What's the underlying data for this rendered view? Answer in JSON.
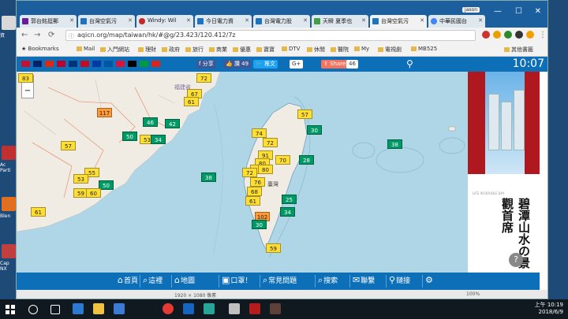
{
  "desktop": {
    "icons": [
      {
        "label": "資",
        "color": "#d8d8d8"
      },
      {
        "label": "Ac Parti",
        "color": "#c03030"
      },
      {
        "label": "Blen",
        "color": "#e07020"
      },
      {
        "label": "Cap NX",
        "color": "#c04040"
      }
    ]
  },
  "browser": {
    "tabs": [
      {
        "label": "郭台銘挺郵",
        "color": "#6a1b9a"
      },
      {
        "label": "台灣空氣污",
        "color": "#1e73be"
      },
      {
        "label": "Windy: Wil",
        "color": "#c62828"
      },
      {
        "label": "今日電力資",
        "color": "#1e73be"
      },
      {
        "label": "台灣電力股",
        "color": "#1e73be"
      },
      {
        "label": "天瞬 夏季也",
        "color": "#43a047"
      },
      {
        "label": "台灣空氣污",
        "color": "#1e73be"
      },
      {
        "label": "中華民國台",
        "color": "#4285f4"
      }
    ],
    "active_tab_index": 6,
    "user_tag": "jason",
    "url": "aqicn.org/map/taiwan/hk/#@g/23.423/120.412/7z",
    "bookmarks": [
      "Bookmarks",
      "Mail",
      "入門網站",
      "理財",
      "政府",
      "旅行",
      "商業",
      "優惠",
      "寶寶",
      "DTV",
      "休閒",
      "醫院",
      "My",
      "電視劇",
      "MB525",
      "其他書籤"
    ],
    "status_left": "1920 × 1080 像素",
    "status_right": "100%"
  },
  "site": {
    "flags": [
      "#c8102e",
      "#012169",
      "#de2910",
      "#bc002d",
      "#003478",
      "#c60b1e",
      "#0039a6",
      "#0055a4",
      "#dc143c",
      "#000000",
      "#009c3b",
      "#da251d"
    ],
    "share_label": "分享",
    "like_label": "讚 49",
    "tweet_label": "推文",
    "gplus_label": "G+",
    "share2_label": "Share",
    "share_count": "46",
    "time": "10:07"
  },
  "map": {
    "labels": [
      "福建省",
      "臺灣"
    ],
    "markers": [
      {
        "v": "83",
        "c": "y"
      },
      {
        "v": "72",
        "c": "y"
      },
      {
        "v": "67",
        "c": "y"
      },
      {
        "v": "61",
        "c": "y"
      },
      {
        "v": "117",
        "c": "o"
      },
      {
        "v": "46",
        "c": "g"
      },
      {
        "v": "42",
        "c": "g"
      },
      {
        "v": "50",
        "c": "g"
      },
      {
        "v": "53",
        "c": "y"
      },
      {
        "v": "34",
        "c": "g"
      },
      {
        "v": "57",
        "c": "y"
      },
      {
        "v": "55",
        "c": "y"
      },
      {
        "v": "53",
        "c": "y"
      },
      {
        "v": "50",
        "c": "g"
      },
      {
        "v": "59",
        "c": "y"
      },
      {
        "v": "60",
        "c": "y"
      },
      {
        "v": "61",
        "c": "y"
      },
      {
        "v": "38",
        "c": "g"
      },
      {
        "v": "57",
        "c": "y"
      },
      {
        "v": "30",
        "c": "g"
      },
      {
        "v": "74",
        "c": "y"
      },
      {
        "v": "72",
        "c": "y"
      },
      {
        "v": "91",
        "c": "y"
      },
      {
        "v": "70",
        "c": "y"
      },
      {
        "v": "80",
        "c": "y"
      },
      {
        "v": "72",
        "c": "y"
      },
      {
        "v": "80",
        "c": "y"
      },
      {
        "v": "72",
        "c": "y"
      },
      {
        "v": "76",
        "c": "y"
      },
      {
        "v": "68",
        "c": "y"
      },
      {
        "v": "61",
        "c": "y"
      },
      {
        "v": "28",
        "c": "g"
      },
      {
        "v": "25",
        "c": "g"
      },
      {
        "v": "34",
        "c": "g"
      },
      {
        "v": "102",
        "c": "o"
      },
      {
        "v": "30",
        "c": "g"
      },
      {
        "v": "38",
        "c": "g"
      },
      {
        "v": "59",
        "c": "y"
      }
    ]
  },
  "ad": {
    "title": "碧潭山水の景觀首席",
    "small": "LIFE IN DOUBLE BAY",
    "help": "?"
  },
  "footer_nav": [
    {
      "label": "首頁",
      "icon": "⌂"
    },
    {
      "label": "這裡",
      "icon": "⌕"
    },
    {
      "label": "地圖",
      "icon": "⌂"
    },
    {
      "label": "口罩！",
      "icon": "▣"
    },
    {
      "label": "常見問題",
      "icon": "⌕"
    },
    {
      "label": "搜索",
      "icon": "⌕"
    },
    {
      "label": "聯繫",
      "icon": "✉"
    },
    {
      "label": "鏈接",
      "icon": "⚲"
    },
    {
      "label": "",
      "icon": "⚙"
    }
  ],
  "taskbar": {
    "time": "上午 10:19",
    "date": "2018/6/9"
  }
}
